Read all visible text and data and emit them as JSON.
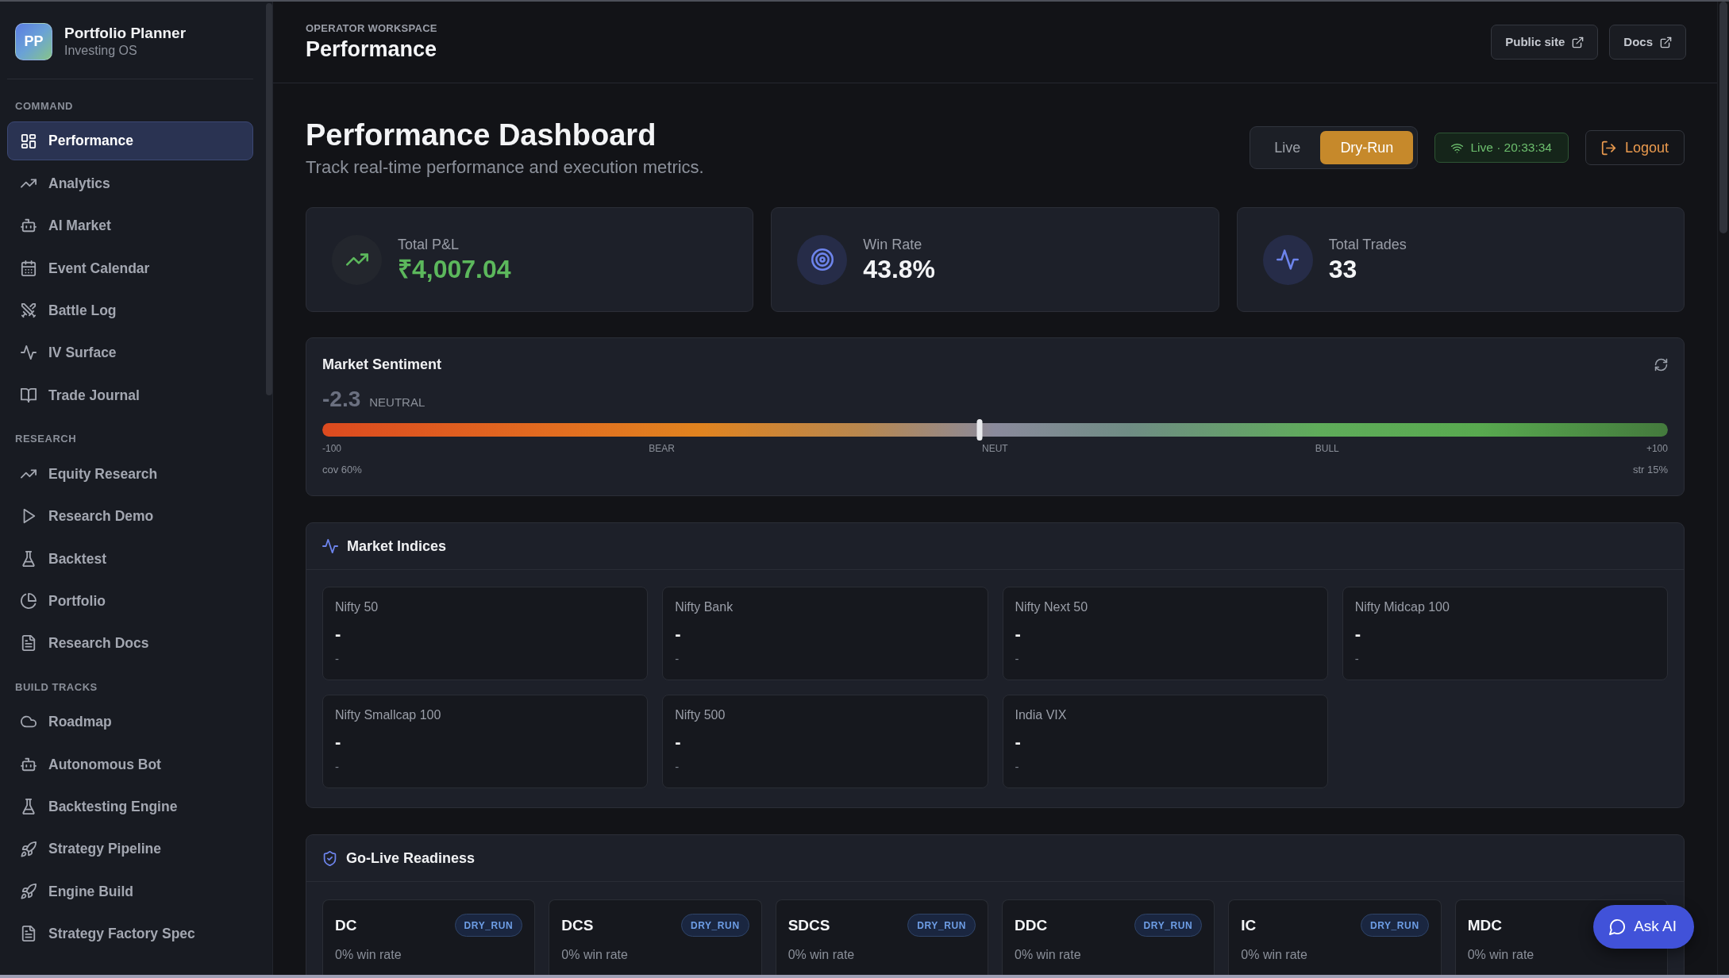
{
  "sidebar": {
    "brand": {
      "logo": "PP",
      "title": "Portfolio Planner",
      "subtitle": "Investing OS"
    },
    "sections": [
      {
        "heading": "COMMAND",
        "items": [
          {
            "label": "Performance",
            "selected": true
          },
          {
            "label": "Analytics",
            "selected": false
          },
          {
            "label": "AI Market",
            "selected": false
          },
          {
            "label": "Event Calendar",
            "selected": false
          },
          {
            "label": "Battle Log",
            "selected": false
          },
          {
            "label": "IV Surface",
            "selected": false
          },
          {
            "label": "Trade Journal",
            "selected": false
          }
        ]
      },
      {
        "heading": "RESEARCH",
        "items": [
          {
            "label": "Equity Research",
            "selected": false
          },
          {
            "label": "Research Demo",
            "selected": false
          },
          {
            "label": "Backtest",
            "selected": false
          },
          {
            "label": "Portfolio",
            "selected": false
          },
          {
            "label": "Research Docs",
            "selected": false
          }
        ]
      },
      {
        "heading": "BUILD TRACKS",
        "items": [
          {
            "label": "Roadmap",
            "selected": false
          },
          {
            "label": "Autonomous Bot",
            "selected": false
          },
          {
            "label": "Backtesting Engine",
            "selected": false
          },
          {
            "label": "Strategy Pipeline",
            "selected": false
          },
          {
            "label": "Engine Build",
            "selected": false
          },
          {
            "label": "Strategy Factory Spec",
            "selected": false
          }
        ]
      }
    ]
  },
  "header": {
    "eyebrow": "OPERATOR WORKSPACE",
    "title": "Performance",
    "links": [
      "Public site",
      "Docs"
    ]
  },
  "dashboard": {
    "title": "Performance Dashboard",
    "subtitle": "Track real-time performance and execution metrics.",
    "modes": [
      {
        "label": "Live",
        "selected": false
      },
      {
        "label": "Dry-Run",
        "selected": true
      }
    ],
    "status": "Live · 20:33:34",
    "logout": "Logout"
  },
  "stats": [
    {
      "label": "Total P&L",
      "value": "₹4,007.04",
      "positive": true
    },
    {
      "label": "Win Rate",
      "value": "43.8%",
      "positive": false
    },
    {
      "label": "Total Trades",
      "value": "33",
      "positive": false
    }
  ],
  "sentiment": {
    "title": "Market Sentiment",
    "score": "-2.3",
    "label": "NEUTRAL",
    "level": 0.4885,
    "scale": [
      "-100",
      "BEAR",
      "NEUT",
      "BULL",
      "+100"
    ],
    "coverage": "cov 60%",
    "strength": "str 15%"
  },
  "indices": {
    "title": "Market Indices",
    "items": [
      {
        "name": "Nifty 50",
        "value": "-",
        "change": "-"
      },
      {
        "name": "Nifty Bank",
        "value": "-",
        "change": "-"
      },
      {
        "name": "Nifty Next 50",
        "value": "-",
        "change": "-"
      },
      {
        "name": "Nifty Midcap 100",
        "value": "-",
        "change": "-"
      },
      {
        "name": "Nifty Smallcap 100",
        "value": "-",
        "change": "-"
      },
      {
        "name": "Nifty 500",
        "value": "-",
        "change": "-"
      },
      {
        "name": "India VIX",
        "value": "-",
        "change": "-"
      }
    ]
  },
  "readiness": {
    "title": "Go-Live Readiness",
    "strategies": [
      {
        "name": "DC",
        "status": "DRY_RUN",
        "win_rate": "0% win rate"
      },
      {
        "name": "DCS",
        "status": "DRY_RUN",
        "win_rate": "0% win rate"
      },
      {
        "name": "SDCS",
        "status": "DRY_RUN",
        "win_rate": "0% win rate"
      },
      {
        "name": "DDC",
        "status": "DRY_RUN",
        "win_rate": "0% win rate"
      },
      {
        "name": "IC",
        "status": "DRY_RUN",
        "win_rate": "0% win rate"
      },
      {
        "name": "MDC",
        "win_rate": "0% win rate"
      }
    ]
  },
  "assistant": {
    "label": "Ask AI"
  }
}
